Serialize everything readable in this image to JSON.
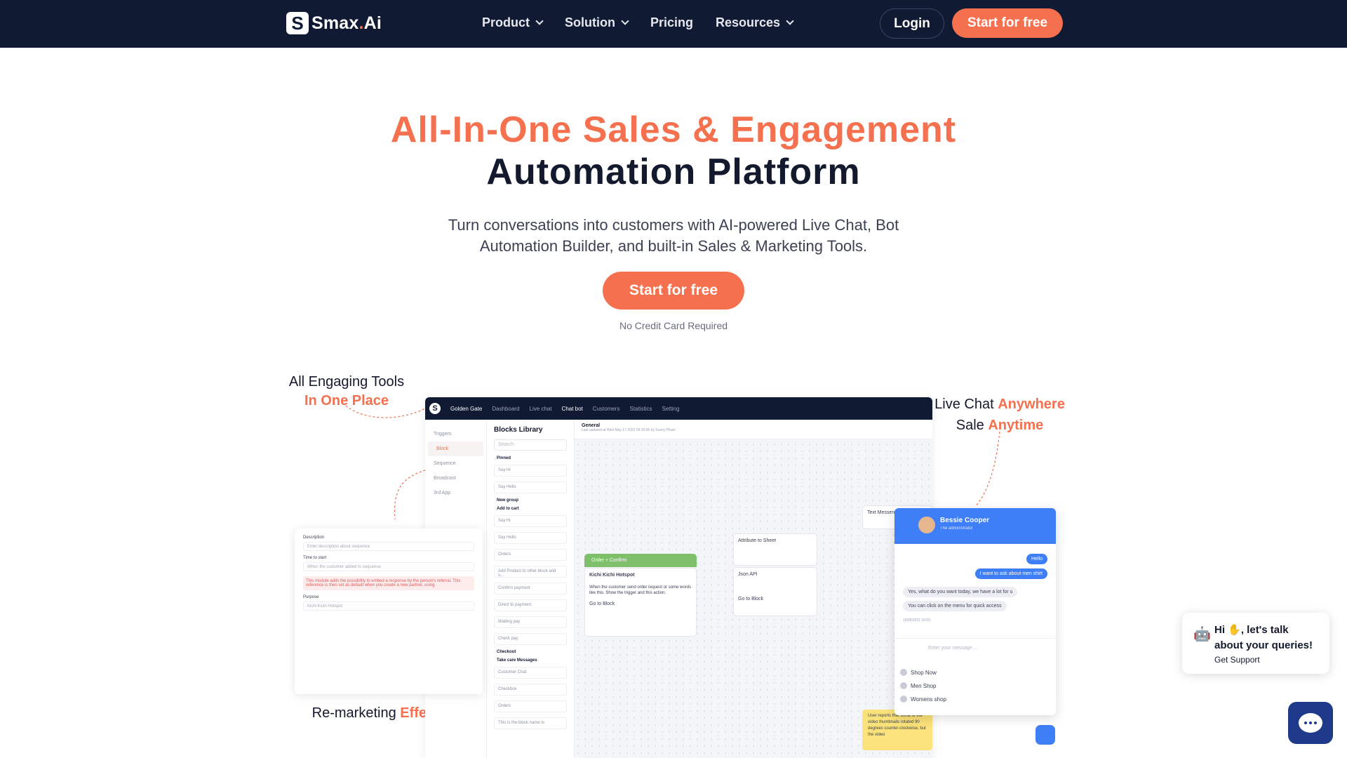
{
  "nav": {
    "logo_mark": "S",
    "logo_name": "Smax",
    "logo_dot": ".",
    "logo_suffix": "Ai",
    "items": [
      {
        "label": "Product",
        "has_dropdown": true
      },
      {
        "label": "Solution",
        "has_dropdown": true
      },
      {
        "label": "Pricing",
        "has_dropdown": false
      },
      {
        "label": "Resources",
        "has_dropdown": true
      }
    ],
    "login": "Login",
    "start": "Start for free"
  },
  "hero": {
    "title_line1": "All-In-One Sales & Engagement",
    "title_line2": "Automation Platform",
    "subtitle": "Turn conversations into customers with AI-powered Live Chat, Bot Automation Builder, and built-in Sales & Marketing Tools.",
    "cta": "Start for free",
    "note": "No Credit Card Required"
  },
  "callouts": {
    "tools_a": "All Engaging Tools",
    "tools_b": "In One Place",
    "live_a": "Live Chat",
    "live_b": "Anywhere",
    "sale_a": "Sale",
    "sale_b": "Anytime",
    "remarket_a": "Re-marketing",
    "remarket_b": "Effectively"
  },
  "app": {
    "workspace": "Golden Gate",
    "tabs": [
      "Dashboard",
      "Live chat",
      "Chat bot",
      "Customers",
      "Statistics",
      "Setting"
    ],
    "active_tab": "Chat bot",
    "left": [
      "Triggers",
      "Block",
      "Sequence",
      "Broadcast",
      "3rd App"
    ],
    "library_title": "Blocks Library",
    "library_search": "Search",
    "pinned": "Pinned",
    "library_items": [
      "Say Hi",
      "Say Hello"
    ],
    "group1": "New group",
    "group2": "Add to cart",
    "library_items2": [
      "Say Hi",
      "Say Hello",
      "Orders",
      "Add Product to other block and s...",
      "Confirm payment",
      "Direct to payment",
      "Waiting pay",
      "Check pay"
    ],
    "group3": "Checkout",
    "group4": "Take care Messages",
    "library_items3": [
      "Customer Chat",
      "Checkbox",
      "Orders",
      "This is the block name lo"
    ],
    "canvas_title": "General",
    "canvas_sub": "Last updated at Wed May 17 2022 09:39:06 by Sunny Pham",
    "node_green": "Order + Confirm",
    "node_shop": "Kichi Kichi Hotspot",
    "node_text": "When the customer send order request or some words like this. Show the trigger and this action.",
    "node_go": "Go to Block",
    "node_sheet": "Attribute to Sheet",
    "node_json": "Json API",
    "node_go2": "Go to Block",
    "node_text_msg": "Text Messenger",
    "yellow_note": "User reports that some of the video thumbnails rotated 90 degrees counter-clockwise, but the video"
  },
  "chat": {
    "name": "Bessie Cooper",
    "role": "The administrator",
    "msg1": "Hello",
    "msg2": "I want to ask about men shirt",
    "msg3": "Yes, what do you want today, we have a lot for u",
    "msg4": "You can click on the menu for quick access",
    "time": "15/05/2021 10:03",
    "placeholder": "Enter your message ...",
    "options": [
      "Shop Now",
      "Men Shop",
      "Womens shop"
    ]
  },
  "form": {
    "desc_label": "Description",
    "desc_ph": "Enter description about sequence",
    "time_label": "Time to start",
    "time_val": "When the customer added to sequence",
    "warning": "This module adds the possibility to embed a response by the person's referral. This reference is then set as default when you create a new partner, using",
    "purpose_label": "Purpose",
    "purpose_val": "Kichi Kichi Hotspot"
  },
  "support": {
    "greeting": "Hi ✋, let's talk about your queries!",
    "link": "Get Support"
  }
}
